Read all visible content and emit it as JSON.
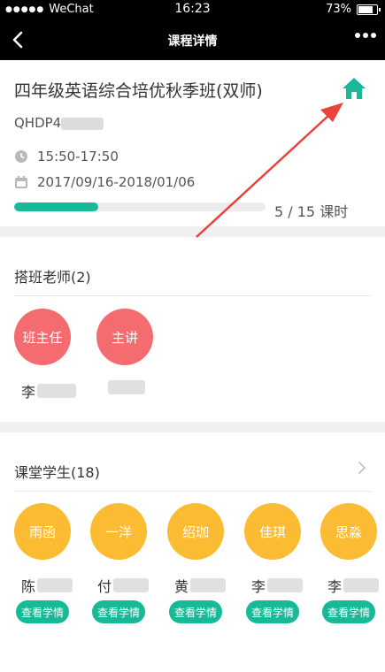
{
  "statusbar": {
    "carrier": "WeChat",
    "time": "16:23",
    "battery": "73%",
    "battery_level": 0.73
  },
  "navbar": {
    "title": "课程详情"
  },
  "course": {
    "title": "四年级英语综合培优秋季班(双师)",
    "code": "QHDP4",
    "time": "15:50-17:50",
    "dates": "2017/09/16-2018/01/06",
    "progress": {
      "completed": 5,
      "total": 15,
      "text": "5 / 15 课时"
    }
  },
  "teachers": {
    "title": "搭班老师(2)",
    "items": [
      {
        "role": "班主任",
        "name": "李"
      },
      {
        "role": "主讲",
        "name": ""
      }
    ]
  },
  "students": {
    "title": "课堂学生(18)",
    "items": [
      {
        "given": "雨函",
        "surname": "陈",
        "action": "查看学情"
      },
      {
        "given": "一洋",
        "surname": "付",
        "action": "查看学情"
      },
      {
        "given": "绍珈",
        "surname": "黄",
        "action": "查看学情"
      },
      {
        "given": "佳琪",
        "surname": "李",
        "action": "查看学情"
      },
      {
        "given": "思淼",
        "surname": "李",
        "action": "查看学情"
      }
    ]
  },
  "colors": {
    "accent": "#18b997",
    "teacher_circle": "#f46b70",
    "student_circle": "#fbbb32",
    "annotation_arrow": "#e8423b"
  },
  "icons": {
    "back": "chevron-left-icon",
    "more": "more-dots-icon",
    "home": "home-icon",
    "time": "clock-icon",
    "date": "calendar-icon",
    "chevron": "chevron-right-icon"
  }
}
